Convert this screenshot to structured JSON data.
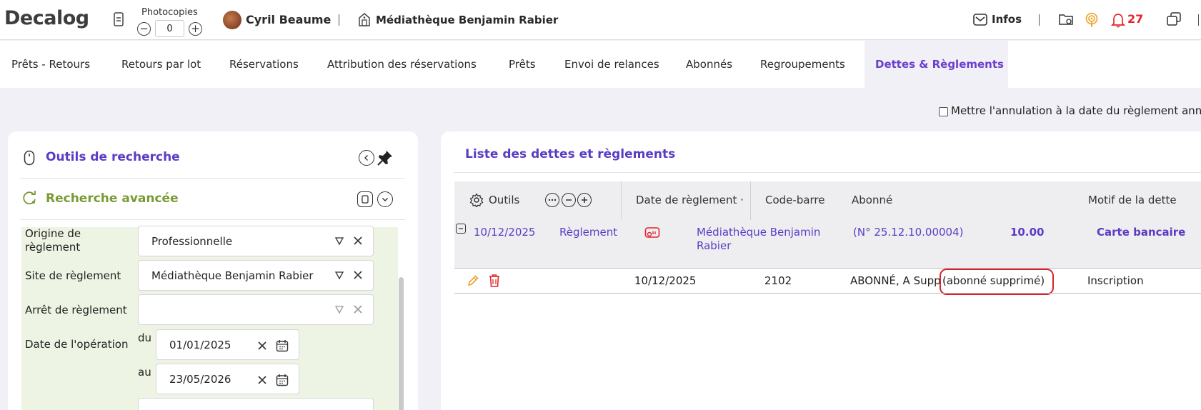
{
  "topbar": {
    "logo": "Decalog",
    "photocopies_label": "Photocopies",
    "photocopies_value": "0",
    "minus_glyph": "−",
    "plus_glyph": "+",
    "user_name": "Cyril Beaume",
    "library_name": "Médiathèque Benjamin Rabier",
    "infos_label": "Infos",
    "notification_count": "27"
  },
  "nav": {
    "tabs": [
      {
        "label": "Prêts - Retours"
      },
      {
        "label": "Retours par lot"
      },
      {
        "label": "Réservations"
      },
      {
        "label": "Attribution des réservations"
      },
      {
        "label": "Prêts"
      },
      {
        "label": "Envoi de relances"
      },
      {
        "label": "Abonnés"
      },
      {
        "label": "Regroupements"
      },
      {
        "label": "Dettes & Règlements",
        "active": true
      }
    ]
  },
  "options": {
    "cancel_date_checkbox_label": "Mettre l'annulation à la date du règlement annu"
  },
  "search_tools": {
    "title": "Outils de recherche",
    "advanced_title": "Recherche avancée",
    "fields": {
      "origin_label": "Origine de règlement",
      "origin_value": "Professionnelle",
      "site_label": "Site de règlement",
      "site_value": "Médiathèque Benjamin Rabier",
      "stop_label": "Arrêt de règlement",
      "stop_value": "",
      "op_date_label": "Date de l'opération",
      "from_label": "du",
      "from_value": "01/01/2025",
      "to_label": "au",
      "to_value": "23/05/2026"
    }
  },
  "list": {
    "title": "Liste des dettes et règlements",
    "tools_label": "Outils",
    "headers": {
      "date": "Date de règlement ·",
      "barcode": "Code-barre",
      "subscriber": "Abonné",
      "reason": "Motif de la dette"
    },
    "group_row": {
      "date": "10/12/2025",
      "type": "Règlement",
      "site": "Médiathèque Benjamin Rabier",
      "reference": "(N° 25.12.10.00004)",
      "amount": "10.00",
      "method": "Carte bancaire"
    },
    "detail_row": {
      "date": "10/12/2025",
      "barcode": "2102",
      "subscriber": "ABONNÉ, A Supp",
      "subscriber_note": "(abonné supprimé)",
      "reason": "Inscription"
    }
  },
  "colors": {
    "accent_purple": "#5b3cc4",
    "advanced_green": "#7a9a34",
    "alert_red": "#e3262c",
    "pencil_orange": "#f0a030"
  }
}
